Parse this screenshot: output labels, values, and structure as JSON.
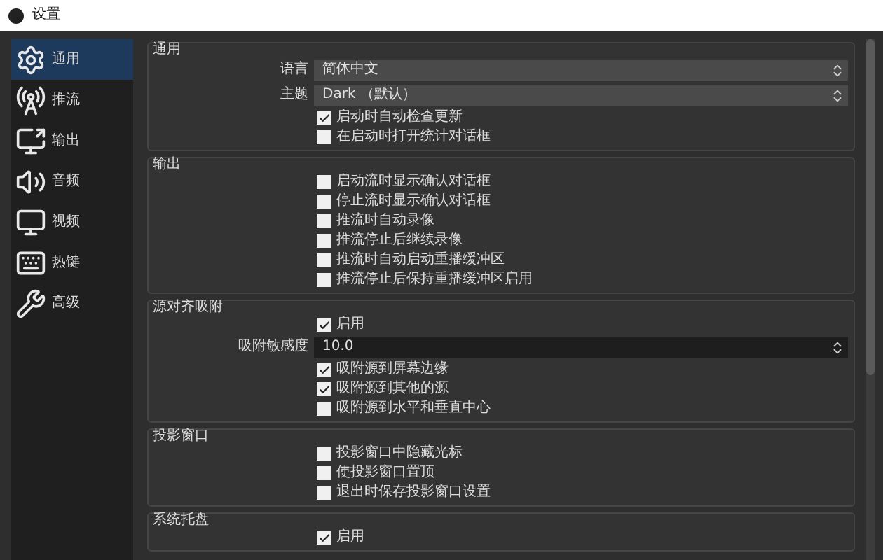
{
  "window": {
    "title": "设置"
  },
  "sidebar": {
    "items": [
      {
        "label": "通用",
        "selected": true
      },
      {
        "label": "推流",
        "selected": false
      },
      {
        "label": "输出",
        "selected": false
      },
      {
        "label": "音频",
        "selected": false
      },
      {
        "label": "视频",
        "selected": false
      },
      {
        "label": "热键",
        "selected": false
      },
      {
        "label": "高级",
        "selected": false
      }
    ]
  },
  "groups": [
    {
      "title": "通用",
      "rows": [
        {
          "kind": "select",
          "label": "语言",
          "value": "简体中文"
        },
        {
          "kind": "select",
          "label": "主题",
          "value": "Dark （默认）"
        },
        {
          "kind": "checkbox",
          "label": "启动时自动检查更新",
          "checked": true
        },
        {
          "kind": "checkbox",
          "label": "在启动时打开统计对话框",
          "checked": false
        }
      ]
    },
    {
      "title": "输出",
      "rows": [
        {
          "kind": "checkbox",
          "label": "启动流时显示确认对话框",
          "checked": false
        },
        {
          "kind": "checkbox",
          "label": "停止流时显示确认对话框",
          "checked": false
        },
        {
          "kind": "checkbox",
          "label": "推流时自动录像",
          "checked": false
        },
        {
          "kind": "checkbox",
          "label": "推流停止后继续录像",
          "checked": false
        },
        {
          "kind": "checkbox",
          "label": "推流时自动启动重播缓冲区",
          "checked": false
        },
        {
          "kind": "checkbox",
          "label": "推流停止后保持重播缓冲区启用",
          "checked": false
        }
      ]
    },
    {
      "title": "源对齐吸附",
      "rows": [
        {
          "kind": "checkbox",
          "label": "启用",
          "checked": true
        },
        {
          "kind": "spin",
          "label": "吸附敏感度",
          "value": "10.0"
        },
        {
          "kind": "checkbox",
          "label": "吸附源到屏幕边缘",
          "checked": true
        },
        {
          "kind": "checkbox",
          "label": "吸附源到其他的源",
          "checked": true
        },
        {
          "kind": "checkbox",
          "label": "吸附源到水平和垂直中心",
          "checked": false
        }
      ]
    },
    {
      "title": "投影窗口",
      "rows": [
        {
          "kind": "checkbox",
          "label": "投影窗口中隐藏光标",
          "checked": false
        },
        {
          "kind": "checkbox",
          "label": "使投影窗口置顶",
          "checked": false
        },
        {
          "kind": "checkbox",
          "label": "退出时保存投影窗口设置",
          "checked": false
        }
      ]
    },
    {
      "title": "系统托盘",
      "rows": [
        {
          "kind": "checkbox",
          "label": "启用",
          "checked": true
        }
      ]
    }
  ]
}
